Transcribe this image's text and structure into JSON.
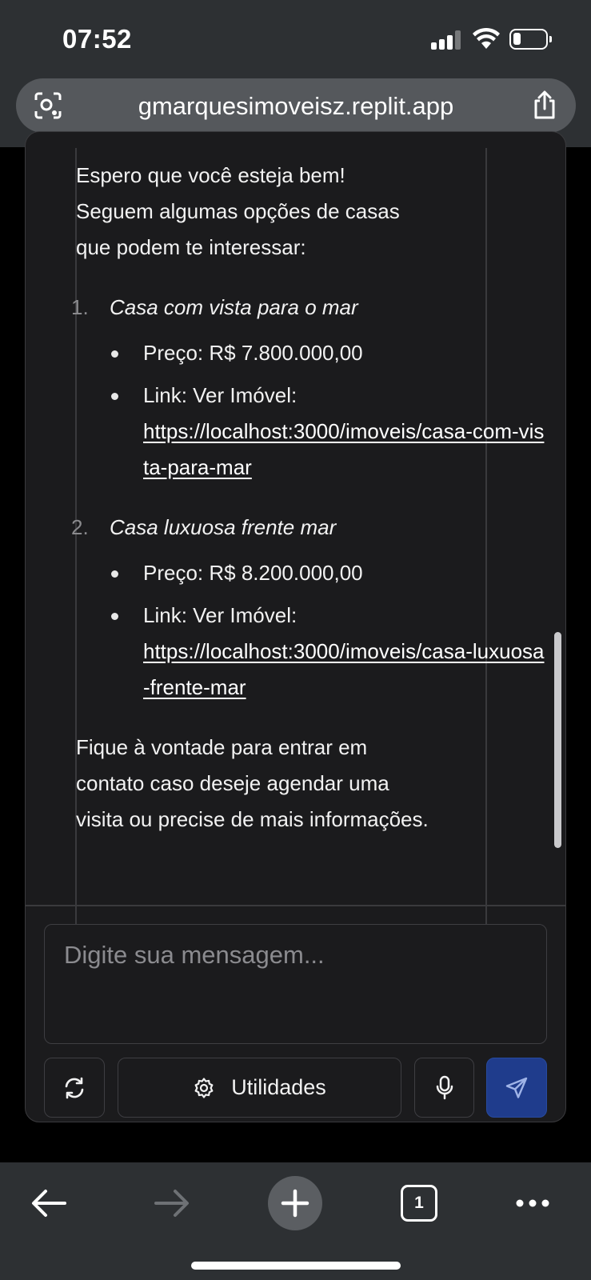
{
  "status_bar": {
    "time": "07:52"
  },
  "browser": {
    "url": "gmarquesimoveisz.replit.app",
    "icons": [
      "camera-search-icon",
      "share-icon"
    ]
  },
  "message": {
    "intro": "Espero que você esteja bem! Seguem algumas opções de casas que podem te interessar:",
    "items": [
      {
        "number": "1.",
        "title": "Casa com vista para o mar",
        "price": "Preço: R$ 7.800.000,00",
        "link_label": "Link: Ver Imóvel:",
        "link_url": "https://localhost:3000/imoveis/casa-com-vista-para-mar"
      },
      {
        "number": "2.",
        "title": "Casa luxuosa frente mar",
        "price": "Preço: R$ 8.200.000,00",
        "link_label": "Link: Ver Imóvel:",
        "link_url": "https://localhost:3000/imoveis/casa-luxuosa-frente-mar"
      }
    ],
    "closing": "Fique à vontade para entrar em contato caso deseje agendar uma visita ou precise de mais informações."
  },
  "composer": {
    "placeholder": "Digite sua mensagem...",
    "utilities_label": "Utilidades",
    "send_color": "#1f3c8c"
  },
  "toolbar": {
    "tab_count": "1"
  }
}
